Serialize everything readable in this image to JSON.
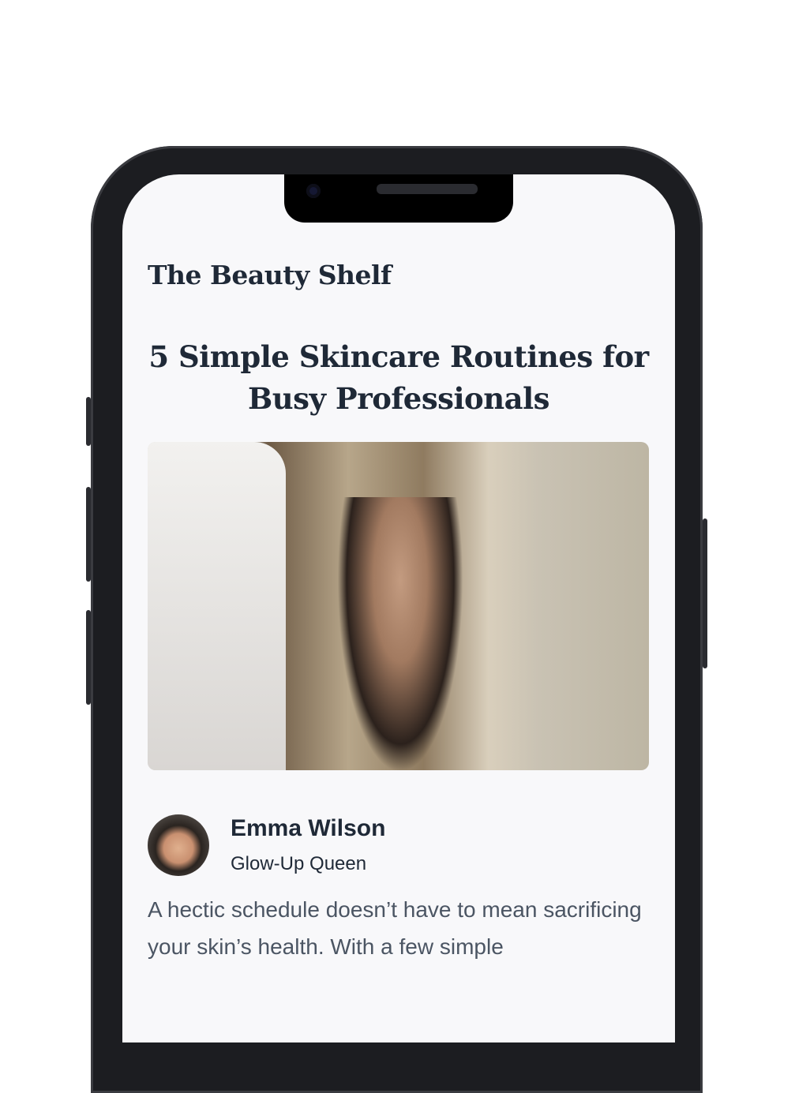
{
  "app": {
    "brand": "The Beauty Shelf"
  },
  "article": {
    "title": "5 Simple Skincare Routines for Busy Professionals",
    "author": {
      "name": "Emma Wilson",
      "role": "Glow-Up Queen"
    },
    "intro": "A hectic schedule doesn’t have to mean sacrificing your skin’s health. With a few simple"
  }
}
